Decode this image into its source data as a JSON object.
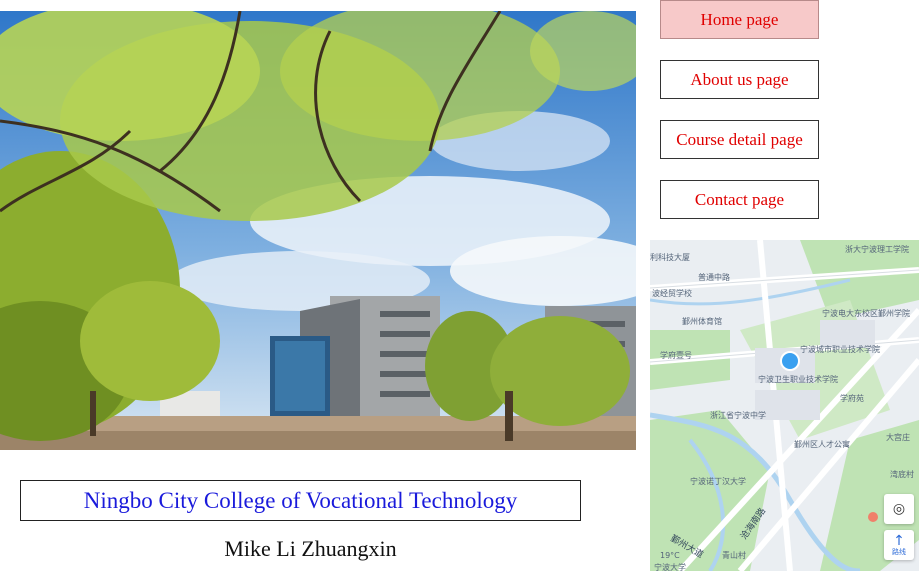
{
  "nav": {
    "items": [
      {
        "label": "Home page",
        "active": true
      },
      {
        "label": "About us page",
        "active": false
      },
      {
        "label": "Course detail page",
        "active": false
      },
      {
        "label": "Contact page",
        "active": false
      }
    ]
  },
  "hero": {
    "icon": "campus-photo"
  },
  "college": {
    "name": "Ningbo City College of Vocational Technology"
  },
  "author": {
    "name": "Mike Li Zhuangxin"
  },
  "map": {
    "labels": {
      "road_putong": "普通中路",
      "weather": "19°C",
      "school_1": "宁波电大东校区鄞州学院",
      "school_2": "宁波城市职业技术学院",
      "school_3": "宁波卫生职业技术学院",
      "school_4": "浙江省宁波中学",
      "place_1": "鄞州体育馆",
      "place_2": "学府壹号",
      "place_3": "学府苑",
      "place_4": "鄞州区人才公寓",
      "place_5": "大宫庄",
      "place_6": "湾底村",
      "place_7": "宁波诺丁汉大学",
      "road_yinzhou": "鄞州大道",
      "road_nanhai": "沧海南路",
      "place_8": "浙大宁波理工学院",
      "place_9": "波经贸学校",
      "place_10": "利科技大厦",
      "place_11": "青山村",
      "place_12": "宁波大学"
    },
    "route_label": "路线",
    "colors": {
      "water": "#aed3f0",
      "green": "#bfe3b4",
      "road": "#ffffff",
      "marker": "#3aa0f0"
    }
  },
  "colors": {
    "nav_text": "#e00000",
    "nav_active_bg": "#f7c9c9",
    "college_text": "#1a1adb"
  }
}
